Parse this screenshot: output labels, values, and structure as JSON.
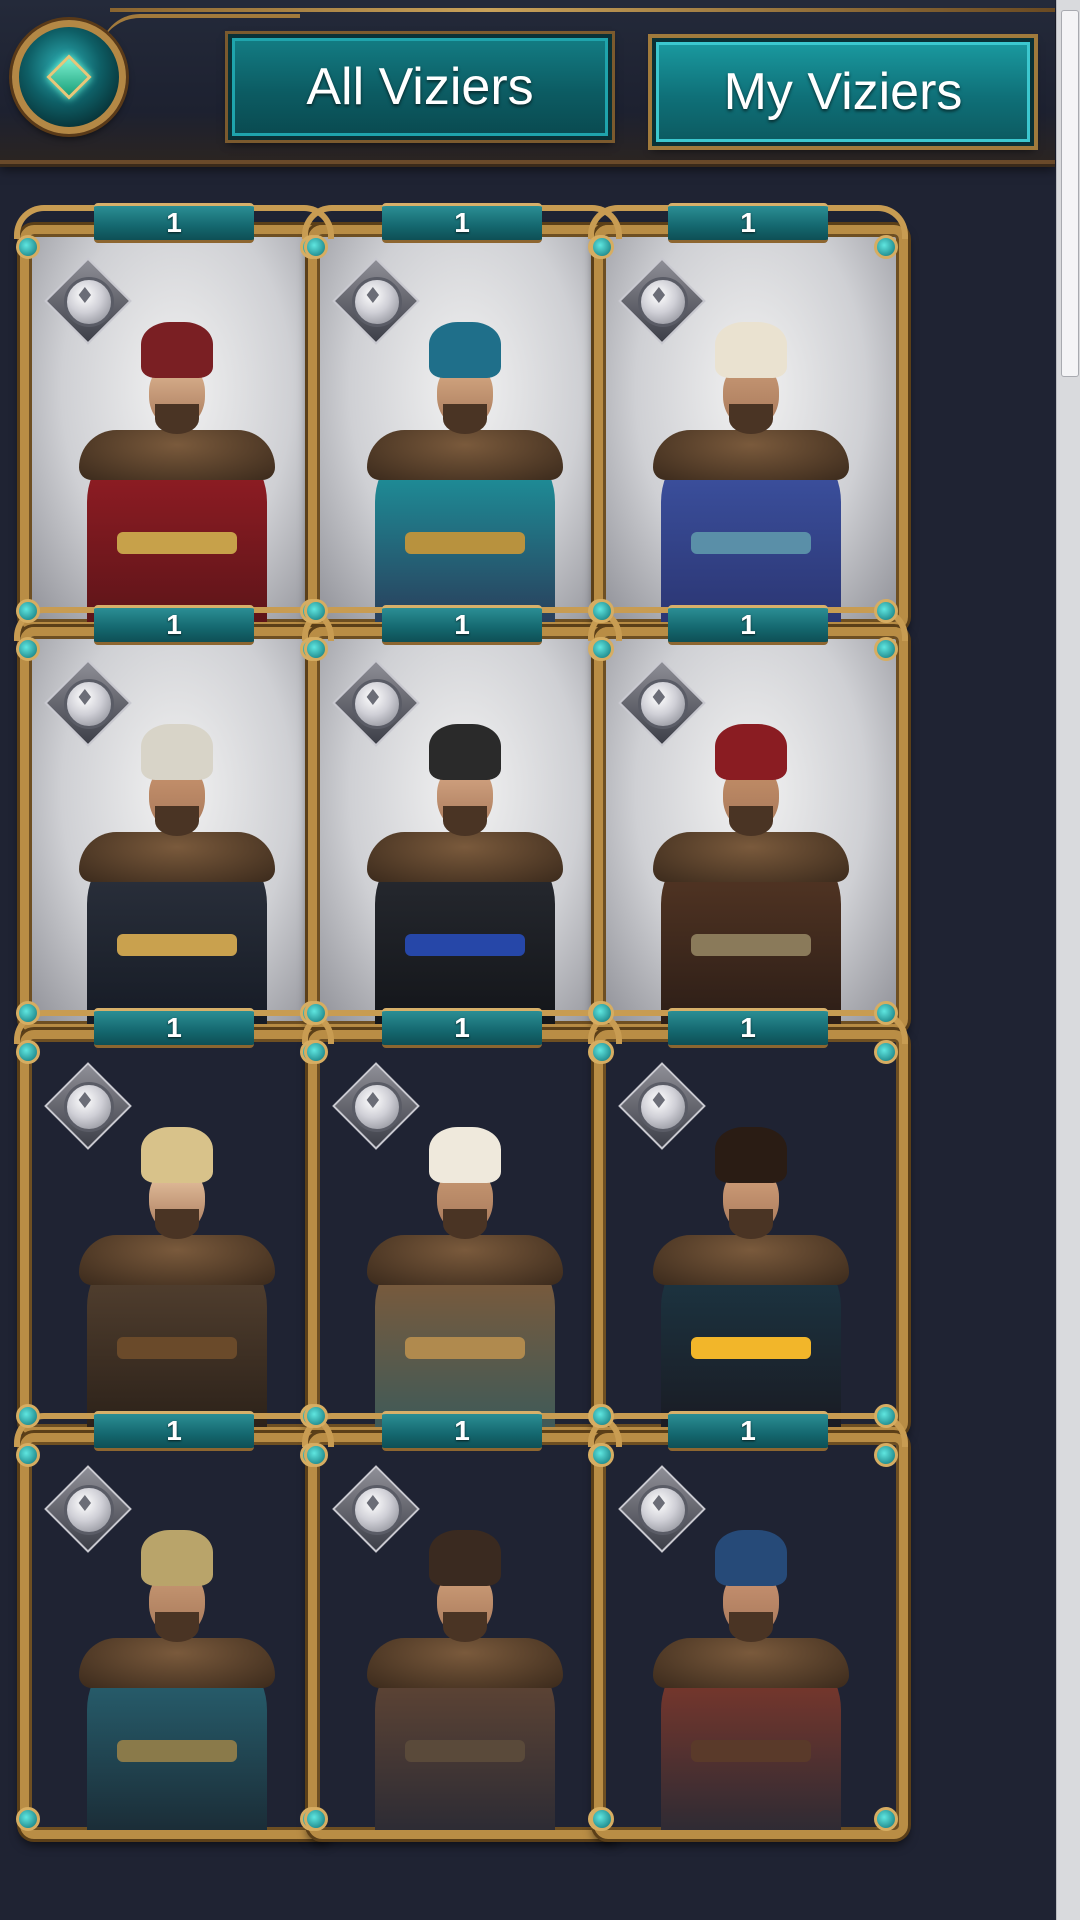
{
  "header": {
    "back_icon": "ornate-back-gem-icon",
    "tabs": [
      {
        "label": "All Viziers",
        "selected": false
      },
      {
        "label": "My Viziers",
        "selected": true
      }
    ]
  },
  "colors": {
    "accent_teal": "#137d84",
    "frame_gold": "#b98d45",
    "background": "#1f2333"
  },
  "viziers": [
    {
      "level": "1",
      "portrait": "vizier-portrait-young-red-vest",
      "class_icon": "silver-class-badge-icon",
      "backdrop": "light"
    },
    {
      "level": "1",
      "portrait": "vizier-portrait-elder-scholar-book",
      "class_icon": "silver-class-badge-icon",
      "backdrop": "light"
    },
    {
      "level": "1",
      "portrait": "vizier-portrait-blue-officer-fur-cape",
      "class_icon": "silver-class-badge-icon",
      "backdrop": "light"
    },
    {
      "level": "1",
      "portrait": "vizier-portrait-janissary-tall-hat",
      "class_icon": "silver-class-badge-icon",
      "backdrop": "light"
    },
    {
      "level": "1",
      "portrait": "vizier-portrait-modern-robe-blue-sash",
      "class_icon": "silver-class-badge-icon",
      "backdrop": "light"
    },
    {
      "level": "1",
      "portrait": "vizier-portrait-crossed-arms-turban",
      "class_icon": "silver-class-badge-icon",
      "backdrop": "light"
    },
    {
      "level": "1",
      "portrait": "vizier-portrait-warrior-woman-spear",
      "class_icon": "silver-class-badge-icon",
      "backdrop": "dark"
    },
    {
      "level": "1",
      "portrait": "vizier-portrait-scholar-white-turban-book",
      "class_icon": "silver-class-badge-icon",
      "backdrop": "dark"
    },
    {
      "level": "1",
      "portrait": "vizier-portrait-noble-golden-chain",
      "class_icon": "silver-class-badge-icon",
      "backdrop": "dark"
    },
    {
      "level": "1",
      "portrait": "vizier-portrait-helmeted-soldier",
      "class_icon": "silver-class-badge-icon",
      "backdrop": "dark"
    },
    {
      "level": "1",
      "portrait": "vizier-portrait-fur-collar-man",
      "class_icon": "silver-class-badge-icon",
      "backdrop": "dark"
    },
    {
      "level": "1",
      "portrait": "vizier-portrait-blue-turban-man",
      "class_icon": "silver-class-badge-icon",
      "backdrop": "dark"
    }
  ]
}
